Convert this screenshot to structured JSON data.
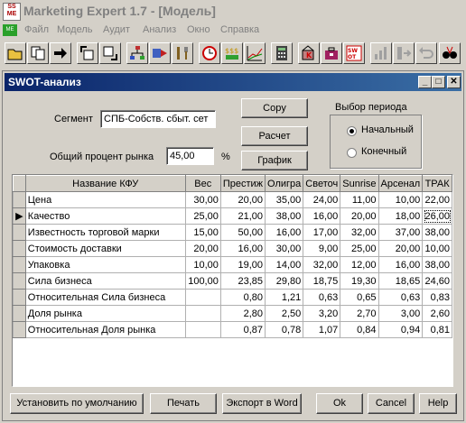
{
  "app": {
    "title": "Marketing Expert 1.7 - [Модель]",
    "logo": "ME"
  },
  "menu": [
    "Файл",
    "Модель",
    "Аудит",
    "Анализ",
    "Окно",
    "Справка"
  ],
  "toolbar": {
    "icons": [
      "open-folder-icon",
      "copy-icon",
      "arrow-right-icon",
      "export-icon",
      "import-icon",
      "network-icon",
      "run-icon",
      "tools-icon",
      "clock-icon",
      "money-icon",
      "chart-icon",
      "calculator-icon",
      "building-icon",
      "briefcase-icon",
      "swot-icon",
      "bar-chart-icon",
      "flow-icon",
      "undo-icon",
      "glasses-icon"
    ]
  },
  "window": {
    "title": "SWOT-анализ"
  },
  "form": {
    "segment_label": "Сегмент",
    "segment_value": "СПБ-Собств. сбыт. сет",
    "market_label": "Общий процент рынка",
    "market_value": "45,00",
    "percent_sign": "%",
    "copy_button": "Copy",
    "calc_button": "Расчет",
    "chart_button": "График",
    "period_label": "Выбор периода",
    "period_initial": "Начальный",
    "period_final": "Конечный"
  },
  "grid": {
    "columns": [
      "Название КФУ",
      "Вес",
      "Престиж",
      "Олигра",
      "Светоч",
      "Sunrise",
      "Арсенал",
      "ТРАК"
    ],
    "rows": [
      [
        "Цена",
        "30,00",
        "20,00",
        "35,00",
        "24,00",
        "11,00",
        "10,00",
        "22,00"
      ],
      [
        "Качество",
        "25,00",
        "21,00",
        "38,00",
        "16,00",
        "20,00",
        "18,00",
        "26,00"
      ],
      [
        "Известность торговой марки",
        "15,00",
        "50,00",
        "16,00",
        "17,00",
        "32,00",
        "37,00",
        "38,00"
      ],
      [
        "Стоимость доставки",
        "20,00",
        "16,00",
        "30,00",
        "9,00",
        "25,00",
        "20,00",
        "10,00"
      ],
      [
        "Упаковка",
        "10,00",
        "19,00",
        "14,00",
        "32,00",
        "12,00",
        "16,00",
        "38,00"
      ],
      [
        "Сила бизнеса",
        "100,00",
        "23,85",
        "29,80",
        "18,75",
        "19,30",
        "18,65",
        "24,60"
      ],
      [
        "Относительная Сила бизнеса",
        "",
        "0,80",
        "1,21",
        "0,63",
        "0,65",
        "0,63",
        "0,83"
      ],
      [
        "Доля рынка",
        "",
        "2,80",
        "2,50",
        "3,20",
        "2,70",
        "3,00",
        "2,60"
      ],
      [
        "Относительная Доля рынка",
        "",
        "0,87",
        "0,78",
        "1,07",
        "0,84",
        "0,94",
        "0,81"
      ]
    ]
  },
  "buttons": {
    "default": "Установить по умолчанию",
    "print": "Печать",
    "export": "Экспорт в Word",
    "ok": "Ok",
    "cancel": "Cancel",
    "help": "Help"
  }
}
